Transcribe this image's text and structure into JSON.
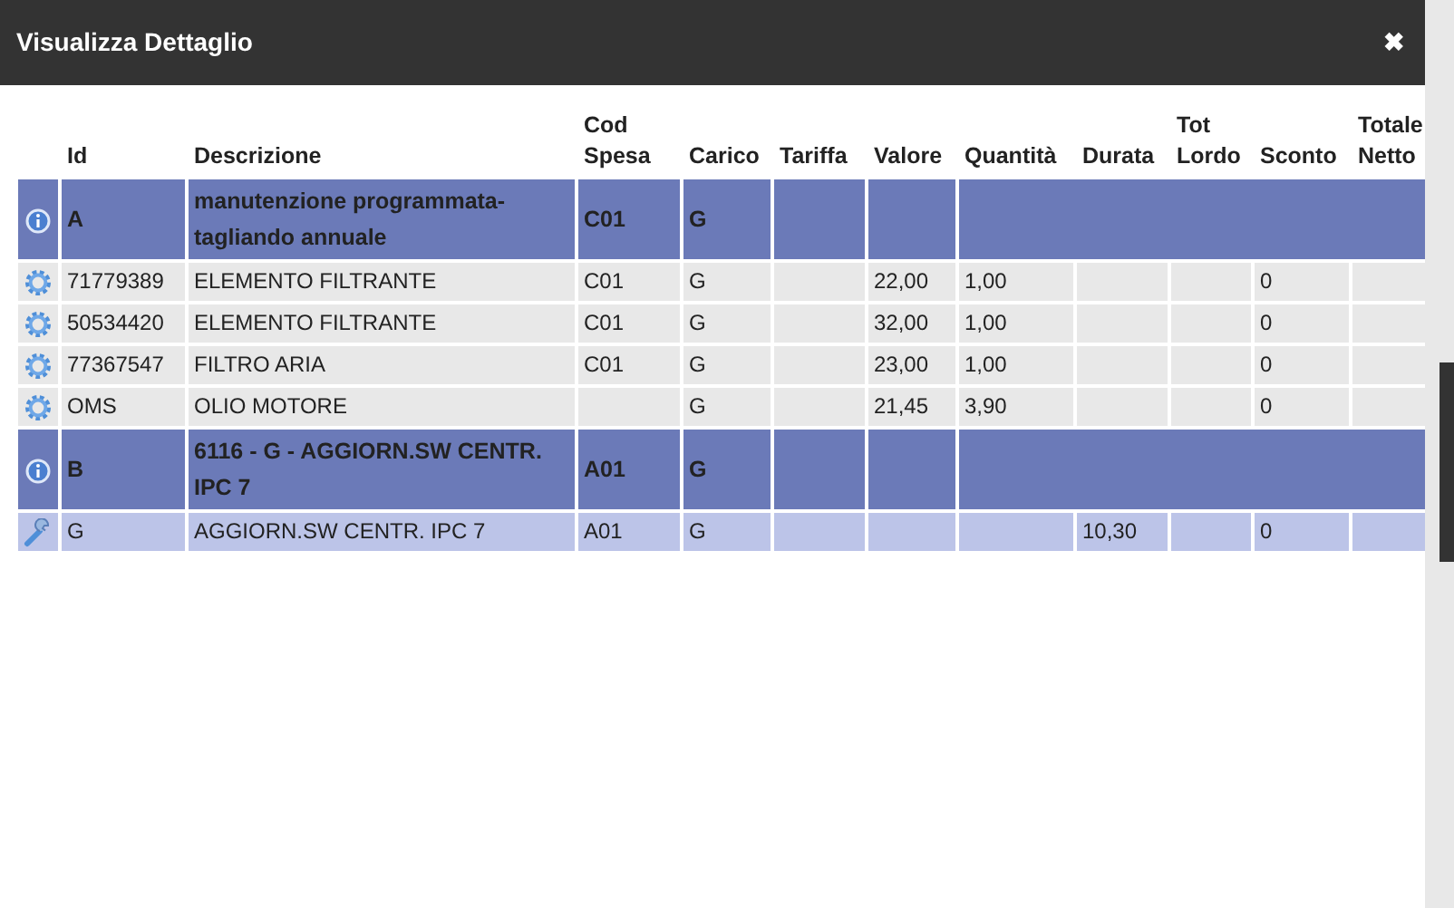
{
  "window": {
    "title": "Visualizza Dettaglio",
    "close": "✖"
  },
  "table": {
    "columns": [
      "",
      "Id",
      "Descrizione",
      "Cod Spesa",
      "Carico",
      "Tariffa",
      "Valore",
      "Quantità",
      "Durata",
      "Tot Lordo",
      "Sconto",
      "Totale Netto"
    ],
    "rows": [
      {
        "kind": "group",
        "cells": [
          "",
          "A",
          "manutenzione programmata-tagliando annuale",
          "C01",
          "G",
          "",
          "",
          ""
        ]
      },
      {
        "kind": "item",
        "cells": [
          "",
          "71779389",
          "ELEMENTO FILTRANTE",
          "C01",
          "G",
          "",
          "22,00",
          "1,00",
          "",
          "",
          "0",
          ""
        ]
      },
      {
        "kind": "item",
        "cells": [
          "",
          "50534420",
          "ELEMENTO FILTRANTE",
          "C01",
          "G",
          "",
          "32,00",
          "1,00",
          "",
          "",
          "0",
          ""
        ]
      },
      {
        "kind": "item",
        "cells": [
          "",
          "77367547",
          "FILTRO ARIA",
          "C01",
          "G",
          "",
          "23,00",
          "1,00",
          "",
          "",
          "0",
          ""
        ]
      },
      {
        "kind": "item",
        "cells": [
          "",
          "OMS",
          "OLIO MOTORE",
          "",
          "G",
          "",
          "21,45",
          "3,90",
          "",
          "",
          "0",
          ""
        ]
      },
      {
        "kind": "group",
        "cells": [
          "",
          "B",
          "6116 - G - AGGIORN.SW CENTR. IPC 7",
          "A01",
          "G",
          "",
          "",
          ""
        ]
      },
      {
        "kind": "service",
        "cells": [
          "",
          "G",
          "AGGIORN.SW CENTR. IPC 7",
          "A01",
          "G",
          "",
          "",
          "",
          "10,30",
          "",
          "0",
          ""
        ]
      }
    ]
  }
}
